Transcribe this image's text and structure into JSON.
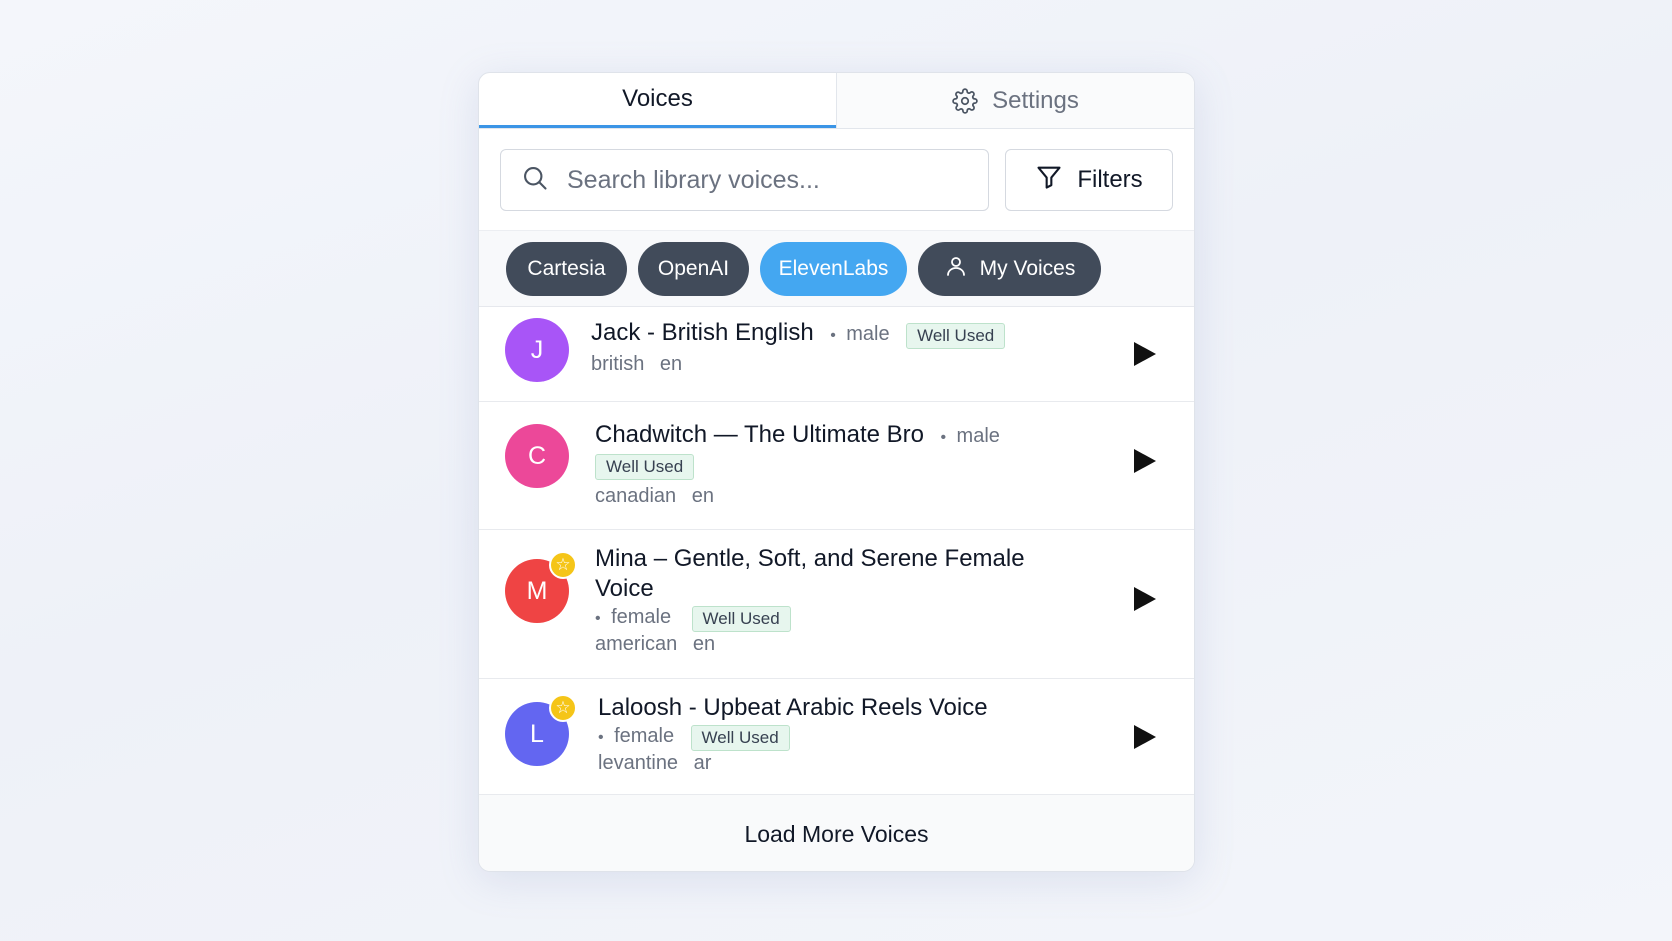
{
  "tabs": {
    "voices": "Voices",
    "settings": "Settings"
  },
  "search": {
    "placeholder": "Search library voices...",
    "filters_label": "Filters"
  },
  "chips": {
    "cartesia": "Cartesia",
    "openai": "OpenAI",
    "elevenlabs": "ElevenLabs",
    "my_voices": "My Voices",
    "active": "ElevenLabs"
  },
  "voices": [
    {
      "initial": "J",
      "name": "Jack - British English",
      "gender": "male",
      "badge": "Well Used",
      "accent": "british",
      "lang": "en",
      "color": "#a855f7",
      "starred": false
    },
    {
      "initial": "C",
      "name": "Chadwitch — The Ultimate Bro",
      "gender": "male",
      "badge": "Well Used",
      "accent": "canadian",
      "lang": "en",
      "color": "#ec4899",
      "starred": false
    },
    {
      "initial": "M",
      "name_line1": "Mina – Gentle, Soft, and Serene Female",
      "name_line2": "Voice",
      "gender": "female",
      "badge": "Well Used",
      "accent": "american",
      "lang": "en",
      "color": "#ef4444",
      "starred": true
    },
    {
      "initial": "L",
      "name": "Laloosh - Upbeat Arabic Reels Voice",
      "gender": "female",
      "badge": "Well Used",
      "accent": "levantine",
      "lang": "ar",
      "color": "#6366f1",
      "starred": true
    }
  ],
  "load_more": "Load More Voices",
  "star_glyph": "☆",
  "dot_glyph": "•",
  "accent_color": "#3b95e6"
}
